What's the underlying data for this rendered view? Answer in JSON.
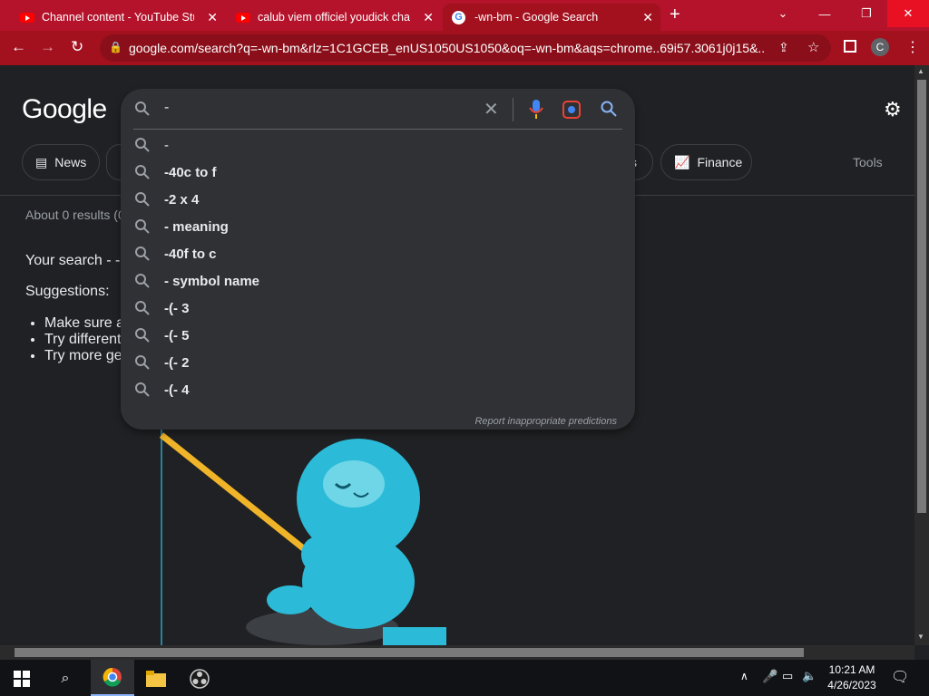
{
  "tabs": [
    {
      "title": "Channel content - YouTube Studio",
      "icon": "youtube-icon"
    },
    {
      "title": "calub viem officiel youdick chann",
      "icon": "youtube-icon"
    },
    {
      "title": "-wn-bm - Google Search",
      "icon": "google-icon",
      "active": true
    }
  ],
  "address": {
    "url": "google.com/search?q=-wn-bm&rlz=1C1GCEB_enUS1050US1050&oq=-wn-bm&aqs=chrome..69i57.3061j0j15&...",
    "profile_initial": "C"
  },
  "page": {
    "logo": "Google",
    "chips": [
      "News",
      "s",
      "Finance"
    ],
    "tools": "Tools",
    "results_count": "About 0 results (0",
    "your_search": "Your search - -",
    "suggestions_label": "Suggestions:",
    "tips": [
      "Make sure a",
      "Try different",
      "Try more ge"
    ]
  },
  "search": {
    "value": "-",
    "suggestions": [
      "-",
      "-40c to f",
      "-2 x 4",
      "- meaning",
      "-40f to c",
      "- symbol name",
      "-(- 3",
      "-(- 5",
      "-(- 2",
      "-(- 4"
    ],
    "report": "Report inappropriate predictions"
  },
  "taskbar": {
    "time": "10:21 AM",
    "date": "4/26/2023"
  },
  "colors": {
    "titlebar": "#b4132b",
    "toolbar": "#a3111f",
    "page_bg": "#202124",
    "dropdown_bg": "#303134"
  }
}
